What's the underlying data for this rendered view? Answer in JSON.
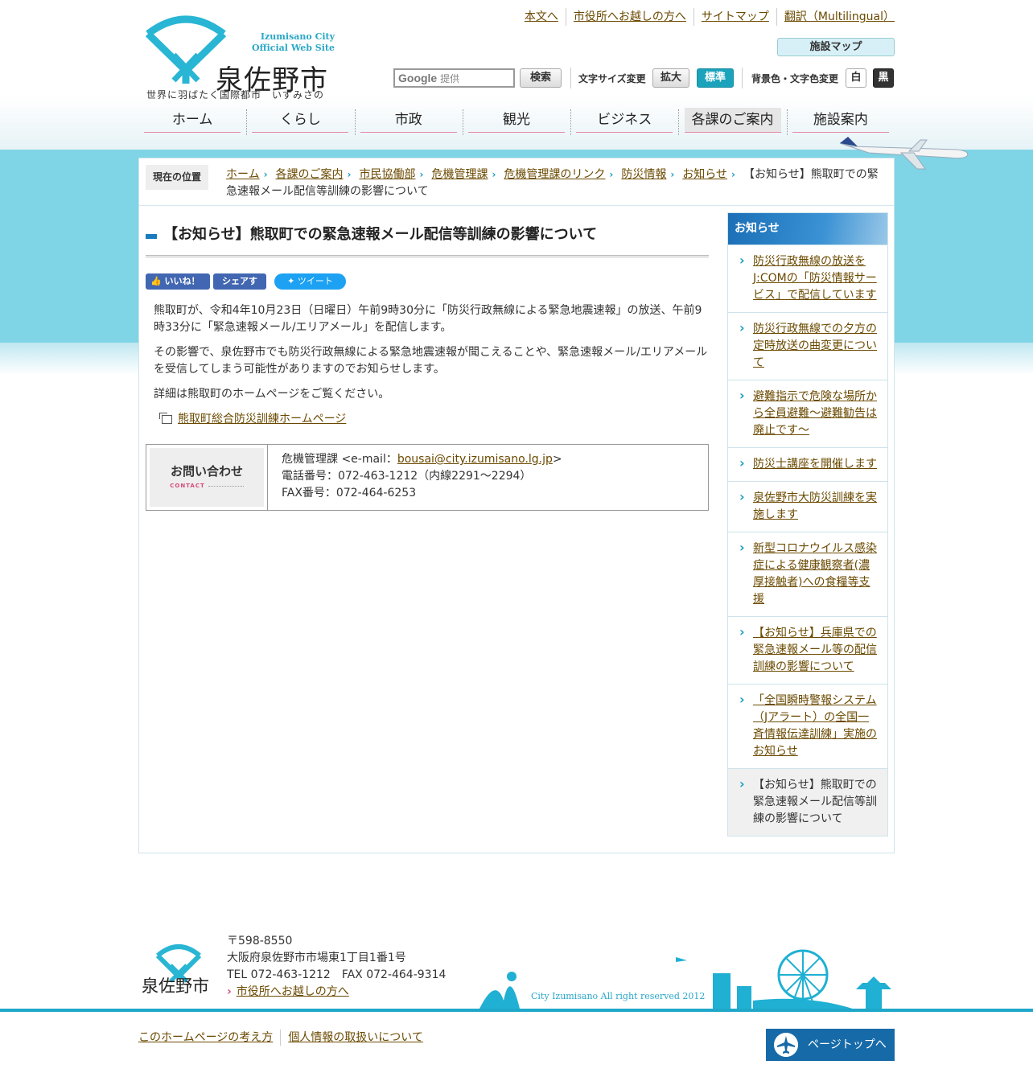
{
  "header": {
    "logo_en_line1": "Izumisano City",
    "logo_en_line2": "Official Web Site",
    "logo_name": "泉佐野市",
    "logo_tagline": "世界に羽ばたく国際都市　いずみさの",
    "top_links": [
      "本文へ",
      "市役所へお越しの方へ",
      "サイトマップ",
      "翻訳（Multilingual）"
    ],
    "facility_map": "施設マップ",
    "search": {
      "placeholder_brand": "Google",
      "placeholder_suffix": "提供",
      "button": "検索"
    },
    "font_size_label": "文字サイズ変更",
    "font_large": "拡大",
    "font_standard": "標準",
    "color_label": "背景色・文字色変更",
    "color_white": "白",
    "color_black": "黒"
  },
  "gnav": [
    "ホーム",
    "くらし",
    "市政",
    "観光",
    "ビジネス",
    "各課のご案内",
    "施設案内"
  ],
  "breadcrumb": {
    "label": "現在の位置",
    "items": [
      "ホーム",
      "各課のご案内",
      "市民協働部",
      "危機管理課",
      "危機管理課のリンク",
      "防災情報",
      "お知らせ"
    ],
    "current": "【お知らせ】熊取町での緊急速報メール配信等訓練の影響について"
  },
  "article": {
    "title": "【お知らせ】熊取町での緊急速報メール配信等訓練の影響について",
    "social": {
      "like": "いいね！",
      "share": "シェアする",
      "tweet": "ツイート"
    },
    "paragraphs": [
      "熊取町が、令和4年10月23日（日曜日）午前9時30分に「防災行政無線による緊急地震速報」の放送、午前9時33分に「緊急速報メール/エリアメール」を配信します。",
      "その影響で、泉佐野市でも防災行政無線による緊急地震速報が聞こえることや、緊急速報メール/エリアメールを受信してしまう可能性がありますのでお知らせします。",
      "詳細は熊取町のホームページをご覧ください。"
    ],
    "external_link": "熊取町総合防災訓練ホームページ"
  },
  "contact": {
    "label_jp": "お問い合わせ",
    "label_en": "CONTACT",
    "dept_prefix": "危機管理課 <e-mail：",
    "email": "bousai@city.izumisano.lg.jp",
    "dept_suffix": ">",
    "phone": "電話番号：072-463-1212（内線2291～2294）",
    "fax": "FAX番号：072-464-6253"
  },
  "sidebar": {
    "heading": "お知らせ",
    "items": [
      "防災行政無線の放送をJ:COMの「防災情報サービス」で配信しています",
      "防災行政無線での夕方の定時放送の曲変更について",
      "避難指示で危険な場所から全員避難～避難勧告は廃止です～",
      "防災士講座を開催します",
      "泉佐野市大防災訓練を実施します",
      "新型コロナウイルス感染症による健康観察者(濃厚接触者)への食糧等支援",
      "【お知らせ】兵庫県での緊急速報メール等の配信訓練の影響について",
      "「全国瞬時警報システム（Jアラート）の全国一斉情報伝達訓練」実施のお知らせ"
    ],
    "current": "【お知らせ】熊取町での緊急速報メール配信等訓練の影響について"
  },
  "footer": {
    "logo_name": "泉佐野市",
    "postal": "〒598-8550",
    "address": "大阪府泉佐野市市場東1丁目1番1号",
    "tel_fax": "TEL 072-463-1212　FAX 072-464-9314",
    "visit_link": "市役所へお越しの方へ",
    "copyright": "City Izumisano All right reserved 2012",
    "links": [
      "このホームページの考え方",
      "個人情報の取扱いについて"
    ],
    "pagetop": "ページトップへ"
  },
  "colors": {
    "accent_cyan": "#1ba3bb",
    "sky_band": "#7fd4e6",
    "link": "#6b4a00",
    "nav_underline": "#e48aa6",
    "pagetop_bg": "#176aa8"
  }
}
